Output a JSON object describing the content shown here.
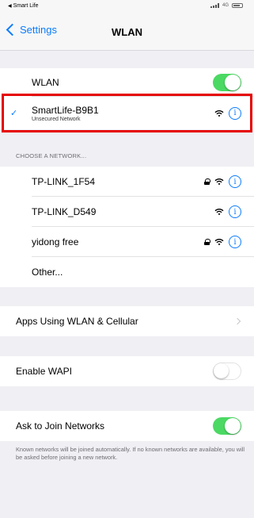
{
  "status_bar": {
    "back_app": "Smart Life",
    "right_text": "4G"
  },
  "nav": {
    "back_label": "Settings",
    "title": "WLAN"
  },
  "wlan": {
    "label": "WLAN",
    "enabled": true
  },
  "connected": {
    "name": "SmartLife-B9B1",
    "subtitle": "Unsecured Network",
    "icons": [
      "check-icon",
      "wifi-icon",
      "info-icon"
    ]
  },
  "choose_header": "CHOOSE A NETWORK...",
  "networks": [
    {
      "name": "TP-LINK_1F54",
      "locked": true
    },
    {
      "name": "TP-LINK_D549",
      "locked": false
    },
    {
      "name": "yidong free",
      "locked": true
    },
    {
      "name": "Other..."
    }
  ],
  "apps_using": {
    "label": "Apps Using WLAN & Cellular"
  },
  "wapi": {
    "label": "Enable WAPI",
    "enabled": false
  },
  "ask_join": {
    "label": "Ask to Join Networks",
    "enabled": true
  },
  "footer": "Known networks will be joined automatically. If no known networks are available, you will be asked before joining a new network.",
  "colors": {
    "accent": "#0a7bfe",
    "toggle_on": "#4bd963",
    "highlight": "#e60000",
    "background": "#efeff4"
  }
}
